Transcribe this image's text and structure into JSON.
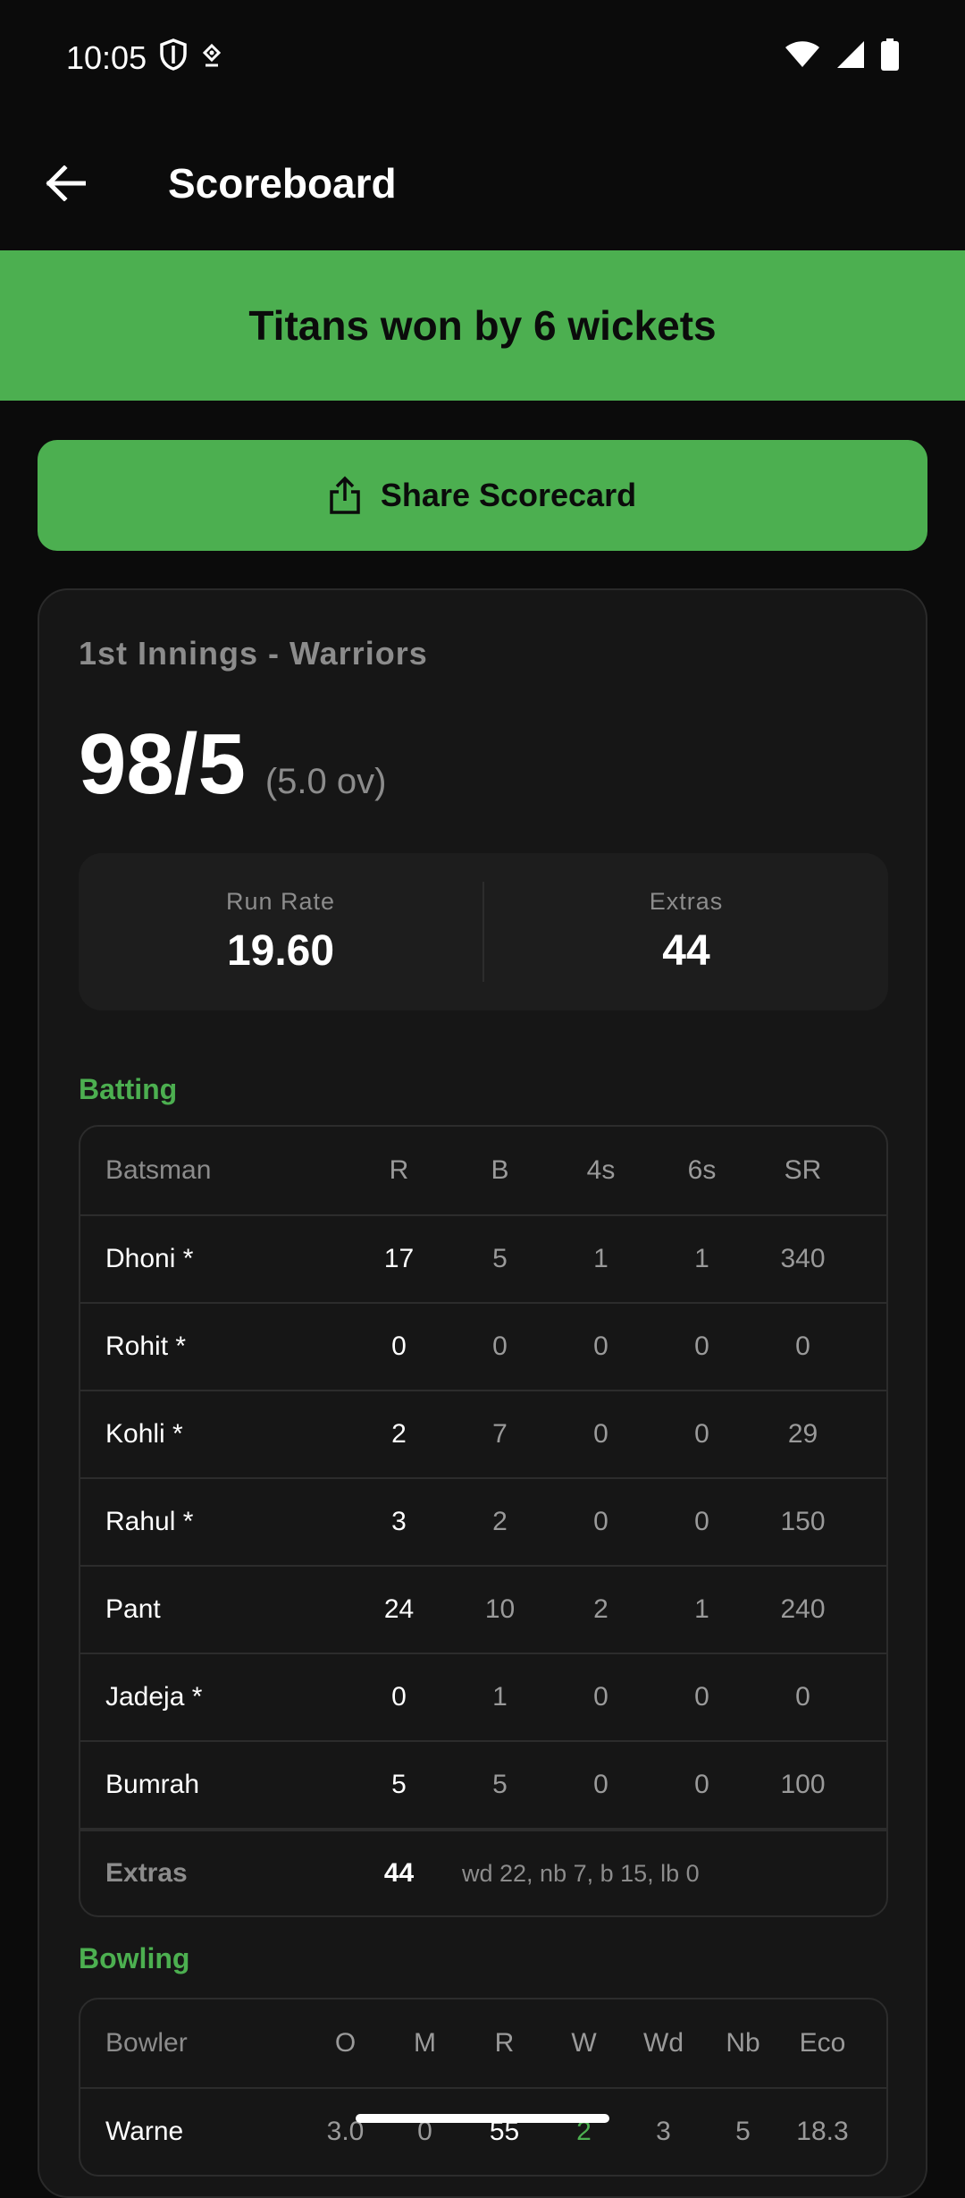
{
  "status": {
    "time": "10:05"
  },
  "header": {
    "title": "Scoreboard"
  },
  "result": {
    "text": "Titans won by 6 wickets"
  },
  "share": {
    "label": "Share Scorecard"
  },
  "innings": {
    "title": "1st Innings - Warriors",
    "score": "98/5",
    "overs": "(5.0 ov)",
    "run_rate_label": "Run Rate",
    "run_rate": "19.60",
    "extras_label": "Extras",
    "extras": "44"
  },
  "batting": {
    "section_label": "Batting",
    "headers": [
      "Batsman",
      "R",
      "B",
      "4s",
      "6s",
      "SR"
    ],
    "rows": [
      {
        "name": "Dhoni *",
        "r": "17",
        "b": "5",
        "fours": "1",
        "sixes": "1",
        "sr": "340"
      },
      {
        "name": "Rohit *",
        "r": "0",
        "b": "0",
        "fours": "0",
        "sixes": "0",
        "sr": "0"
      },
      {
        "name": "Kohli *",
        "r": "2",
        "b": "7",
        "fours": "0",
        "sixes": "0",
        "sr": "29"
      },
      {
        "name": "Rahul *",
        "r": "3",
        "b": "2",
        "fours": "0",
        "sixes": "0",
        "sr": "150"
      },
      {
        "name": "Pant",
        "r": "24",
        "b": "10",
        "fours": "2",
        "sixes": "1",
        "sr": "240"
      },
      {
        "name": "Jadeja *",
        "r": "0",
        "b": "1",
        "fours": "0",
        "sixes": "0",
        "sr": "0"
      },
      {
        "name": "Bumrah",
        "r": "5",
        "b": "5",
        "fours": "0",
        "sixes": "0",
        "sr": "100"
      }
    ],
    "extras_label": "Extras",
    "extras_value": "44",
    "extras_detail": "wd 22, nb 7, b 15, lb 0"
  },
  "bowling": {
    "section_label": "Bowling",
    "headers": [
      "Bowler",
      "O",
      "M",
      "R",
      "W",
      "Wd",
      "Nb",
      "Eco"
    ],
    "rows": [
      {
        "name": "Warne",
        "o": "3.0",
        "m": "0",
        "r": "55",
        "w": "2",
        "wd": "3",
        "nb": "5",
        "eco": "18.3"
      }
    ]
  },
  "colors": {
    "accent": "#4caf50",
    "background": "#0b0b0b",
    "card": "#161616"
  }
}
